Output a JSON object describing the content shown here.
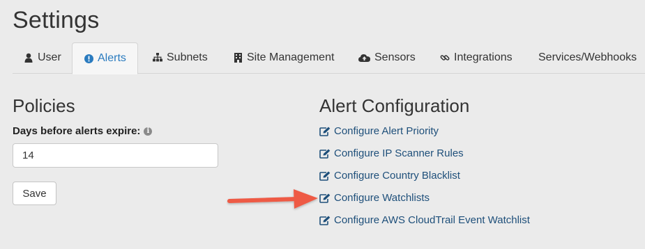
{
  "page": {
    "title": "Settings"
  },
  "tabs": [
    {
      "label": "User",
      "icon": "user-icon",
      "active": false
    },
    {
      "label": "Alerts",
      "icon": "exclamation-circle-icon",
      "active": true
    },
    {
      "label": "Subnets",
      "icon": "sitemap-icon",
      "active": false
    },
    {
      "label": "Site Management",
      "icon": "building-icon",
      "active": false
    },
    {
      "label": "Sensors",
      "icon": "cloud-upload-icon",
      "active": false
    },
    {
      "label": "Integrations",
      "icon": "link-icon",
      "active": false
    },
    {
      "label": "Services/Webhooks",
      "icon": "",
      "active": false
    }
  ],
  "policies": {
    "title": "Policies",
    "days_label": "Days before alerts expire:",
    "days_value": "14",
    "save_label": "Save"
  },
  "alert_config": {
    "title": "Alert Configuration",
    "links": [
      "Configure Alert Priority",
      "Configure IP Scanner Rules",
      "Configure Country Blacklist",
      "Configure Watchlists",
      "Configure AWS CloudTrail Event Watchlist"
    ]
  },
  "colors": {
    "active_tab": "#2a7bbf",
    "link": "#1e4f7a",
    "annotation_arrow": "#ee5a45"
  }
}
